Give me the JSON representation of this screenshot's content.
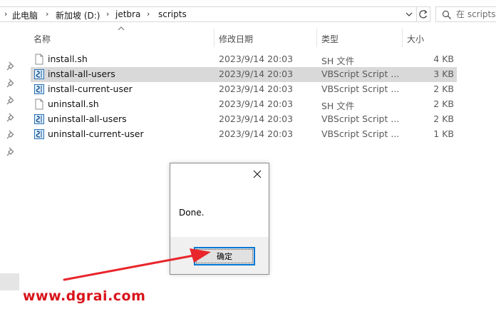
{
  "address_bar": {
    "path": [
      "此电脑",
      "新加坡 (D:)",
      "jetbra",
      "scripts"
    ]
  },
  "search": {
    "placeholder": "在 scripts 中搜"
  },
  "columns": {
    "name": "名称",
    "date": "修改日期",
    "type": "类型",
    "size": "大小"
  },
  "files": [
    {
      "name": "install.sh",
      "date": "2023/9/14 20:03",
      "type": "SH 文件",
      "size": "4 KB",
      "icon": "text-file-icon",
      "selected": false
    },
    {
      "name": "install-all-users",
      "date": "2023/9/14 20:03",
      "type": "VBScript Script ...",
      "size": "3 KB",
      "icon": "vbscript-file-icon",
      "selected": true
    },
    {
      "name": "install-current-user",
      "date": "2023/9/14 20:03",
      "type": "VBScript Script ...",
      "size": "2 KB",
      "icon": "vbscript-file-icon",
      "selected": false
    },
    {
      "name": "uninstall.sh",
      "date": "2023/9/14 20:03",
      "type": "SH 文件",
      "size": "2 KB",
      "icon": "text-file-icon",
      "selected": false
    },
    {
      "name": "uninstall-all-users",
      "date": "2023/9/14 20:03",
      "type": "VBScript Script ...",
      "size": "2 KB",
      "icon": "vbscript-file-icon",
      "selected": false
    },
    {
      "name": "uninstall-current-user",
      "date": "2023/9/14 20:03",
      "type": "VBScript Script ...",
      "size": "1 KB",
      "icon": "vbscript-file-icon",
      "selected": false
    }
  ],
  "dialog": {
    "message": "Done.",
    "ok_label": "确定"
  },
  "watermark": "www.dgrai.com",
  "colors": {
    "selection": "#d9d9d9",
    "focus_border": "#0078d7",
    "annotation_red": "#e8262c",
    "watermark_red": "#d9141b"
  }
}
